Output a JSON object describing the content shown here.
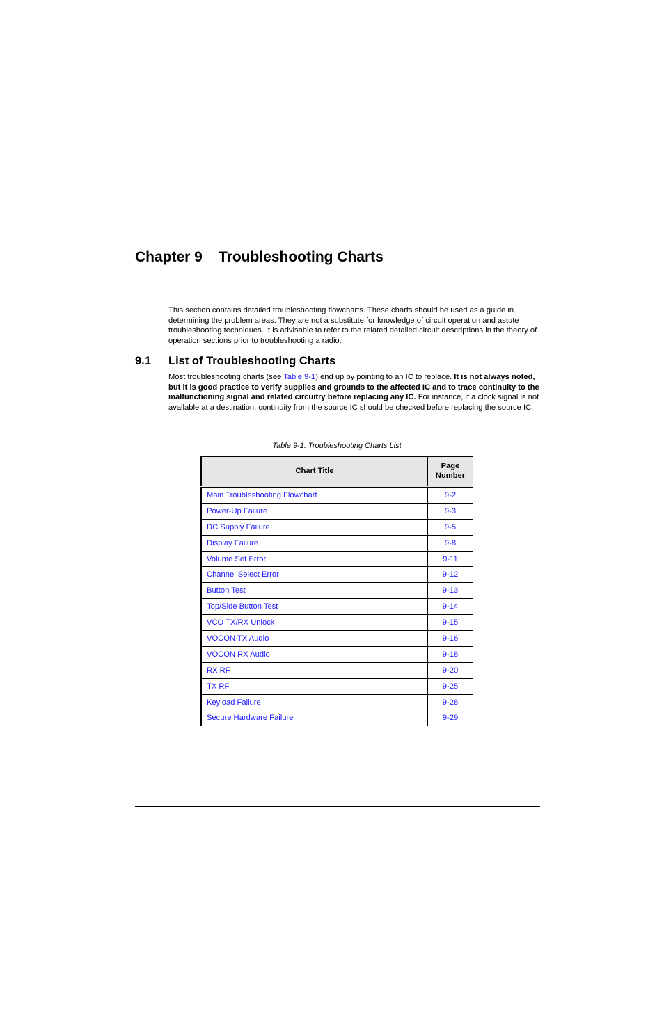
{
  "chapter": {
    "number_label": "Chapter 9",
    "title": "Troubleshooting Charts"
  },
  "intro": {
    "text": "This section contains detailed troubleshooting flowcharts. These charts should be used as a guide in determining the problem areas. They are not a substitute for knowledge of circuit operation and astute troubleshooting techniques. It is advisable to refer to the related detailed circuit descriptions in the theory of operation sections prior to troubleshooting a radio."
  },
  "section": {
    "number": "9.1",
    "title": "List of Troubleshooting Charts",
    "para_start": "Most troubleshooting charts (see ",
    "para_link": "Table 9-1",
    "para_after_link": ") end up by pointing to an IC to replace. ",
    "para_bold": "It is not always noted, but it is good practice to verify supplies and grounds to the affected IC and to trace continuity to the malfunctioning signal and related circuitry before replacing any IC.",
    "para_end": " For instance, if a clock signal is not available at a destination, continuity from the source IC should be checked before replacing the source IC."
  },
  "table": {
    "caption": "Table 9-1.  Troubleshooting Charts List",
    "headers": {
      "title": "Chart Title",
      "page_line1": "Page",
      "page_line2": "Number"
    },
    "rows": [
      {
        "title": "Main Troubleshooting Flowchart",
        "page": "9-2"
      },
      {
        "title": "Power-Up Failure",
        "page": "9-3"
      },
      {
        "title": "DC Supply Failure",
        "page": "9-5"
      },
      {
        "title": "Display Failure",
        "page": "9-8"
      },
      {
        "title": "Volume Set Error",
        "page": "9-11"
      },
      {
        "title": "Channel Select Error",
        "page": "9-12"
      },
      {
        "title": "Button Test",
        "page": "9-13"
      },
      {
        "title": "Top/Side Button Test",
        "page": "9-14"
      },
      {
        "title": "VCO TX/RX Unlock",
        "page": "9-15"
      },
      {
        "title": "VOCON TX Audio",
        "page": "9-16"
      },
      {
        "title": "VOCON RX Audio",
        "page": "9-18"
      },
      {
        "title": "RX RF",
        "page": "9-20"
      },
      {
        "title": "TX RF",
        "page": "9-25"
      },
      {
        "title": "Keyload Failure",
        "page": "9-28"
      },
      {
        "title": "Secure Hardware Failure",
        "page": "9-29"
      }
    ]
  },
  "colors": {
    "link": "#1a1aff",
    "header_bg": "#e6e6e6"
  }
}
